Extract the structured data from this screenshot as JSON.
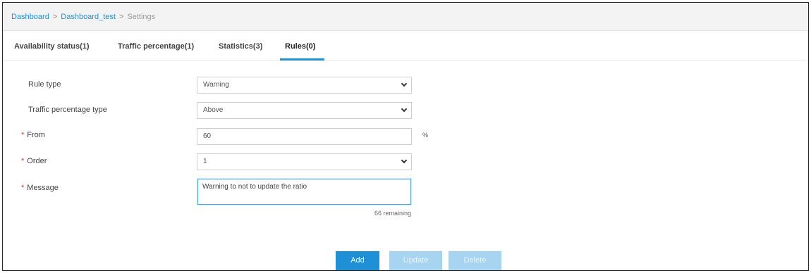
{
  "breadcrumb": {
    "items": [
      "Dashboard",
      "Dashboard_test",
      "Settings"
    ],
    "separator": ">"
  },
  "tabs": [
    {
      "label": "Availability status(1)",
      "active": false
    },
    {
      "label": "Traffic percentage(1)",
      "active": false
    },
    {
      "label": "Statistics(3)",
      "active": false
    },
    {
      "label": "Rules(0)",
      "active": true
    }
  ],
  "form": {
    "rule_type": {
      "label": "Rule type",
      "value": "Warning",
      "required": false
    },
    "traffic_percentage_type": {
      "label": "Traffic percentage type",
      "value": "Above",
      "required": false
    },
    "from": {
      "label": "From",
      "value": "60",
      "unit": "%",
      "required": true
    },
    "order": {
      "label": "Order",
      "value": "1",
      "required": true
    },
    "message": {
      "label": "Message",
      "value": "Warning to not to update the ratio",
      "required": true,
      "remaining": "66 remaining"
    },
    "required_marker": "*"
  },
  "buttons": {
    "add": "Add",
    "update": "Update",
    "delete": "Delete"
  },
  "colors": {
    "accent": "#1f8fd6",
    "disabled": "#a6d4f1",
    "required": "#d9342b"
  }
}
